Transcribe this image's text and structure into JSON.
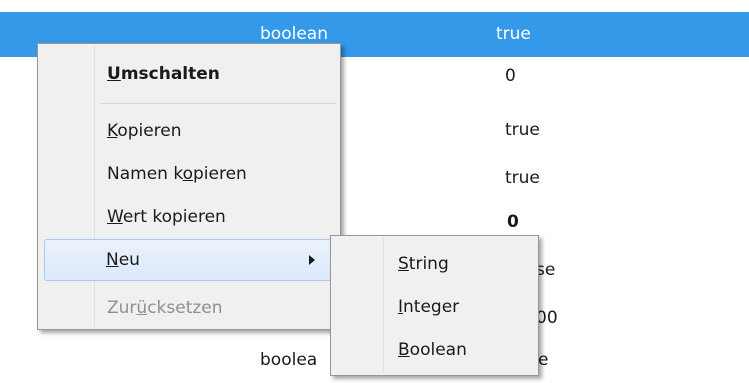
{
  "table": {
    "rows": [
      {
        "type": "boolean",
        "value": "true",
        "selected": true
      },
      {
        "type": "",
        "value": "0"
      },
      {
        "type": "",
        "value": "true"
      },
      {
        "type": "",
        "value": "true"
      },
      {
        "type": "",
        "value": "0",
        "bold": true
      },
      {
        "type": "",
        "value": "se"
      },
      {
        "type": "",
        "value": "00"
      },
      {
        "type": "boolea",
        "value": "e"
      }
    ],
    "selected_color": "#3399e8"
  },
  "context_menu": {
    "toggle": {
      "label": "Umschalten",
      "accel": "U"
    },
    "copy": {
      "label": "Kopieren",
      "accel": "K"
    },
    "copy_name": {
      "label": "Namen kopieren",
      "accel": "o"
    },
    "copy_value": {
      "label": "Wert kopieren",
      "accel": "W"
    },
    "new": {
      "label": "Neu",
      "accel": "N"
    },
    "reset": {
      "label": "Zurücksetzen",
      "accel": "ü"
    }
  },
  "submenu": {
    "string": {
      "label": "String",
      "accel": "S"
    },
    "integer": {
      "label": "Integer",
      "accel": "I"
    },
    "boolean": {
      "label": "Boolean",
      "accel": "B"
    }
  }
}
